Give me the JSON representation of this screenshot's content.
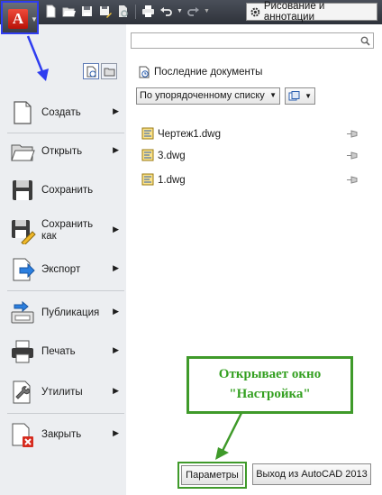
{
  "quick_access": {
    "app_letter": "A",
    "icons": [
      "new-icon",
      "open-icon",
      "save-icon",
      "save-as-icon",
      "plot-preview-icon",
      "print-icon",
      "undo-icon",
      "redo-icon"
    ],
    "workspace_label": "Рисование и аннотации"
  },
  "menu": {
    "items": [
      {
        "label": "Создать",
        "icon": "new-document-icon",
        "has_submenu": true
      },
      {
        "label": "Открыть",
        "icon": "open-folder-icon",
        "has_submenu": true
      },
      {
        "label": "Сохранить",
        "icon": "save-floppy-icon",
        "has_submenu": false
      },
      {
        "label": "Сохранить как",
        "icon": "save-as-pencil-icon",
        "has_submenu": true
      },
      {
        "label": "Экспорт",
        "icon": "export-icon",
        "has_submenu": true
      },
      {
        "label": "Публикация",
        "icon": "publish-icon",
        "has_submenu": true
      },
      {
        "label": "Печать",
        "icon": "printer-icon",
        "has_submenu": true
      },
      {
        "label": "Утилиты",
        "icon": "wrench-icon",
        "has_submenu": true
      },
      {
        "label": "Закрыть",
        "icon": "close-document-icon",
        "has_submenu": true
      }
    ]
  },
  "recent": {
    "header": "Последние документы",
    "sort_value": "По упорядоченному списку",
    "documents": [
      {
        "name": "Чертеж1.dwg"
      },
      {
        "name": "3.dwg"
      },
      {
        "name": "1.dwg"
      }
    ]
  },
  "annotation": {
    "line1": "Открывает окно",
    "line2": "\"Настройка\""
  },
  "footer": {
    "options_label": "Параметры",
    "exit_label": "Выход из AutoCAD 2013"
  },
  "colors": {
    "highlight_blue": "#2f3df0",
    "annotation_green": "#3f9a2a",
    "toolbar_dark": "#3a3e46",
    "panel_gray": "#eceef1"
  }
}
